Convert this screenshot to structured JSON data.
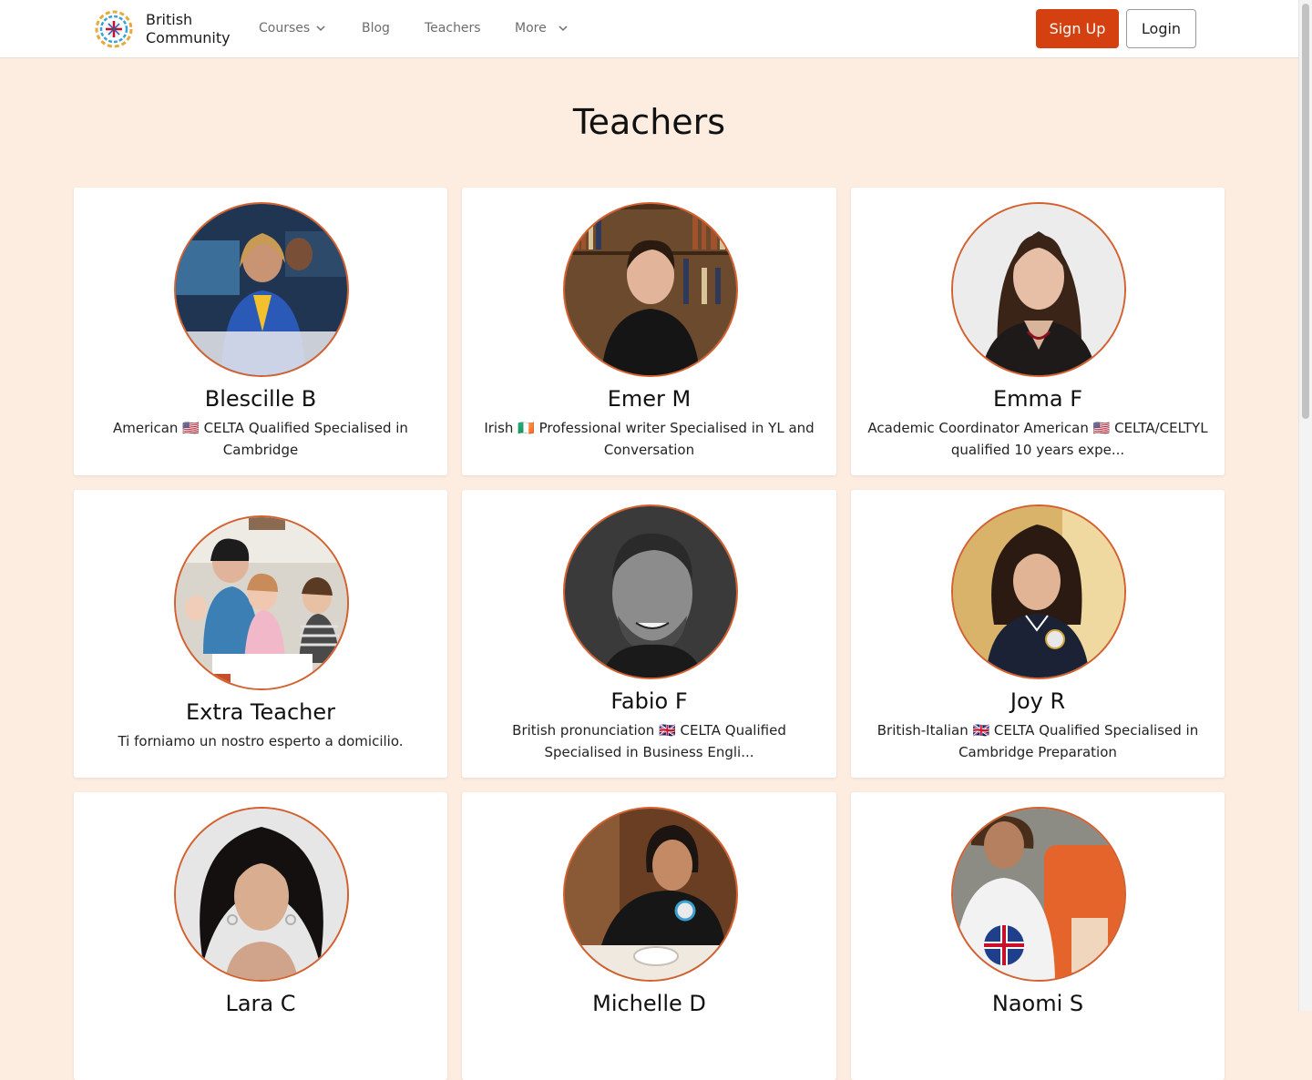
{
  "header": {
    "brand_line1": "British",
    "brand_line2": "Community",
    "nav": {
      "courses": "Courses",
      "blog": "Blog",
      "teachers": "Teachers",
      "more": "More"
    },
    "signup_label": "Sign Up",
    "login_label": "Login"
  },
  "page": {
    "title": "Teachers"
  },
  "colors": {
    "accent": "#d4400f",
    "avatar_border": "#d4602e",
    "background": "#fdece0"
  },
  "teachers": [
    {
      "name": "Blescille B",
      "description": "American 🇺🇸 CELTA Qualified Specialised in Cambridge"
    },
    {
      "name": "Emer M",
      "description": "Irish 🇮🇪 Professional writer Specialised in YL and Conversation"
    },
    {
      "name": "Emma F",
      "description": "Academic Coordinator American 🇺🇸 CELTA/CELTYL qualified 10 years expe..."
    },
    {
      "name": "Extra Teacher",
      "description": "Ti forniamo un nostro esperto a domicilio."
    },
    {
      "name": "Fabio F",
      "description": "British pronunciation 🇬🇧 CELTA Qualified Specialised in Business Engli..."
    },
    {
      "name": "Joy R",
      "description": "British-Italian 🇬🇧 CELTA Qualified Specialised in Cambridge Preparation"
    },
    {
      "name": "Lara C",
      "description": ""
    },
    {
      "name": "Michelle D",
      "description": ""
    },
    {
      "name": "Naomi S",
      "description": ""
    }
  ]
}
